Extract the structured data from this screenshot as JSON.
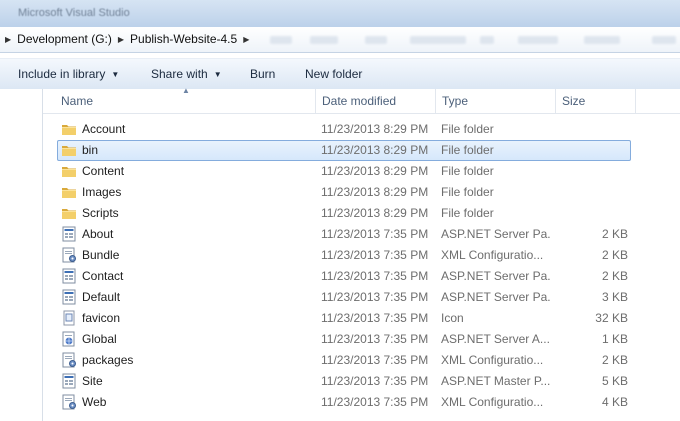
{
  "window": {
    "title": "Microsoft Visual Studio"
  },
  "address": {
    "crumbs": [
      "Development (G:)",
      "Publish-Website-4.5"
    ]
  },
  "toolbar": {
    "include_in_library": "Include in library",
    "share_with": "Share with",
    "burn": "Burn",
    "new_folder": "New folder"
  },
  "columns": {
    "name": "Name",
    "date": "Date modified",
    "type": "Type",
    "size": "Size"
  },
  "files": [
    {
      "name": "Account",
      "date": "11/23/2013 8:29 PM",
      "type": "File folder",
      "size": "",
      "icon": "folder-icon"
    },
    {
      "name": "bin",
      "date": "11/23/2013 8:29 PM",
      "type": "File folder",
      "size": "",
      "icon": "folder-icon"
    },
    {
      "name": "Content",
      "date": "11/23/2013 8:29 PM",
      "type": "File folder",
      "size": "",
      "icon": "folder-icon"
    },
    {
      "name": "Images",
      "date": "11/23/2013 8:29 PM",
      "type": "File folder",
      "size": "",
      "icon": "folder-icon"
    },
    {
      "name": "Scripts",
      "date": "11/23/2013 8:29 PM",
      "type": "File folder",
      "size": "",
      "icon": "folder-icon"
    },
    {
      "name": "About",
      "date": "11/23/2013 7:35 PM",
      "type": "ASP.NET Server Pa...",
      "size": "2 KB",
      "icon": "aspx-page-icon"
    },
    {
      "name": "Bundle",
      "date": "11/23/2013 7:35 PM",
      "type": "XML Configuratio...",
      "size": "2 KB",
      "icon": "config-file-icon"
    },
    {
      "name": "Contact",
      "date": "11/23/2013 7:35 PM",
      "type": "ASP.NET Server Pa...",
      "size": "2 KB",
      "icon": "aspx-page-icon"
    },
    {
      "name": "Default",
      "date": "11/23/2013 7:35 PM",
      "type": "ASP.NET Server Pa...",
      "size": "3 KB",
      "icon": "aspx-page-icon"
    },
    {
      "name": "favicon",
      "date": "11/23/2013 7:35 PM",
      "type": "Icon",
      "size": "32 KB",
      "icon": "icon-file-icon"
    },
    {
      "name": "Global",
      "date": "11/23/2013 7:35 PM",
      "type": "ASP.NET Server A...",
      "size": "1 KB",
      "icon": "asax-file-icon"
    },
    {
      "name": "packages",
      "date": "11/23/2013 7:35 PM",
      "type": "XML Configuratio...",
      "size": "2 KB",
      "icon": "config-file-icon"
    },
    {
      "name": "Site",
      "date": "11/23/2013 7:35 PM",
      "type": "ASP.NET Master P...",
      "size": "5 KB",
      "icon": "aspx-page-icon"
    },
    {
      "name": "Web",
      "date": "11/23/2013 7:35 PM",
      "type": "XML Configuratio...",
      "size": "4 KB",
      "icon": "config-file-icon"
    }
  ],
  "selected_index": 1,
  "colors": {
    "selection_border": "#84acdd",
    "folder": "#e8c15a",
    "header_text": "#4c607a"
  }
}
